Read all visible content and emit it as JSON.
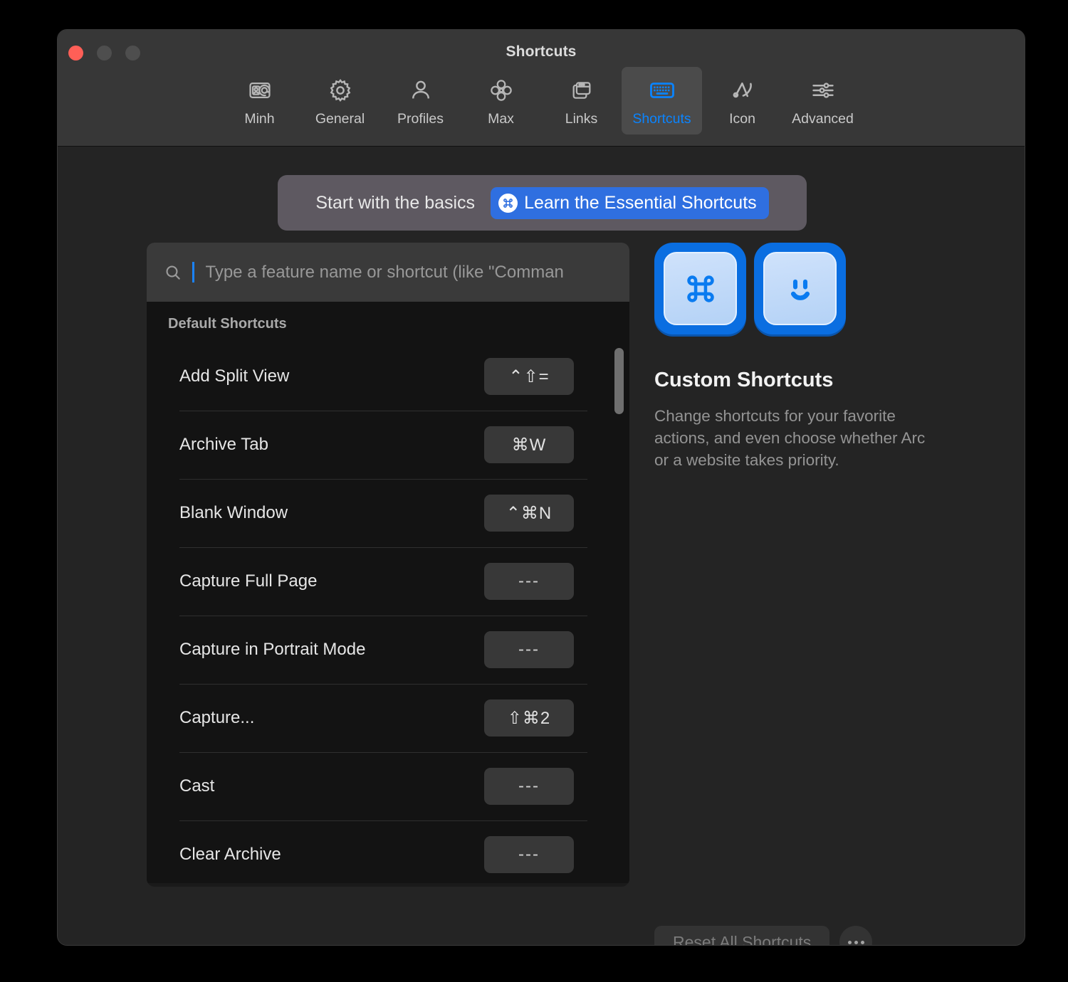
{
  "window": {
    "title": "Shortcuts",
    "controls": {
      "close": "close",
      "minimize": "minimize",
      "maximize": "maximize"
    }
  },
  "toolbar": {
    "tabs": [
      {
        "label": "Minh",
        "icon": "contact-card-icon",
        "active": false
      },
      {
        "label": "General",
        "icon": "gear-icon",
        "active": false
      },
      {
        "label": "Profiles",
        "icon": "person-icon",
        "active": false
      },
      {
        "label": "Max",
        "icon": "flower-icon",
        "active": false
      },
      {
        "label": "Links",
        "icon": "windows-icon",
        "active": false
      },
      {
        "label": "Shortcuts",
        "icon": "keyboard-icon",
        "active": true
      },
      {
        "label": "Icon",
        "icon": "arc-logo-icon",
        "active": false
      },
      {
        "label": "Advanced",
        "icon": "sliders-icon",
        "active": false
      }
    ]
  },
  "banner": {
    "text": "Start with the basics",
    "button_label": "Learn the Essential Shortcuts",
    "button_icon": "command-key-icon",
    "accent": "#2f6fe0",
    "background": "#5e5961"
  },
  "search": {
    "icon": "search-icon",
    "value": "",
    "placeholder": "Type a feature name or shortcut (like \"Comman",
    "caret_color": "#1b83ff"
  },
  "list": {
    "section_title": "Default Shortcuts",
    "rows": [
      {
        "name": "Add Split View",
        "shortcut": "⌃⇧="
      },
      {
        "name": "Archive Tab",
        "shortcut": "⌘W"
      },
      {
        "name": "Blank Window",
        "shortcut": "⌃⌘N"
      },
      {
        "name": "Capture Full Page",
        "shortcut": "---"
      },
      {
        "name": "Capture in Portrait Mode",
        "shortcut": "---"
      },
      {
        "name": "Capture...",
        "shortcut": "⇧⌘2"
      },
      {
        "name": "Cast",
        "shortcut": "---"
      },
      {
        "name": "Clear Archive",
        "shortcut": "---"
      }
    ]
  },
  "detail": {
    "keycaps": [
      {
        "icon": "command-key-icon"
      },
      {
        "icon": "smiley-face-key-icon"
      }
    ],
    "title": "Custom Shortcuts",
    "description": "Change shortcuts for your favorite actions, and even choose whether Arc or a website takes priority.",
    "keycap_color": "#0a6ee1",
    "keycap_face_color": "#bcd8f7"
  },
  "footer": {
    "reset_label": "Reset All Shortcuts",
    "more_label": "more-options"
  }
}
